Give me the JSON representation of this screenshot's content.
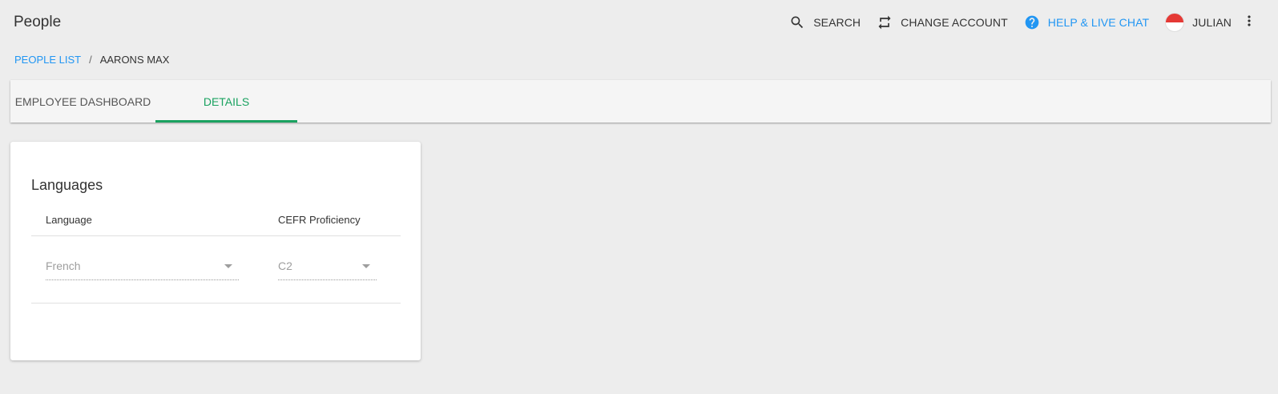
{
  "app": {
    "title": "People"
  },
  "header": {
    "search_label": "SEARCH",
    "change_account_label": "CHANGE ACCOUNT",
    "help_label": "HELP & LIVE CHAT",
    "user_name": "JULIAN",
    "help_color": "#2196f3"
  },
  "breadcrumb": {
    "parent": "PEOPLE LIST",
    "separator": "/",
    "current": "AARONS MAX"
  },
  "tabs": [
    {
      "label": "EMPLOYEE DASHBOARD",
      "active": false
    },
    {
      "label": "DETAILS",
      "active": true
    }
  ],
  "accent_color": "#1aa260",
  "languages_card": {
    "title": "Languages",
    "columns": [
      "Language",
      "CEFR Proficiency"
    ],
    "rows": [
      {
        "language": "French",
        "proficiency": "C2"
      }
    ]
  }
}
